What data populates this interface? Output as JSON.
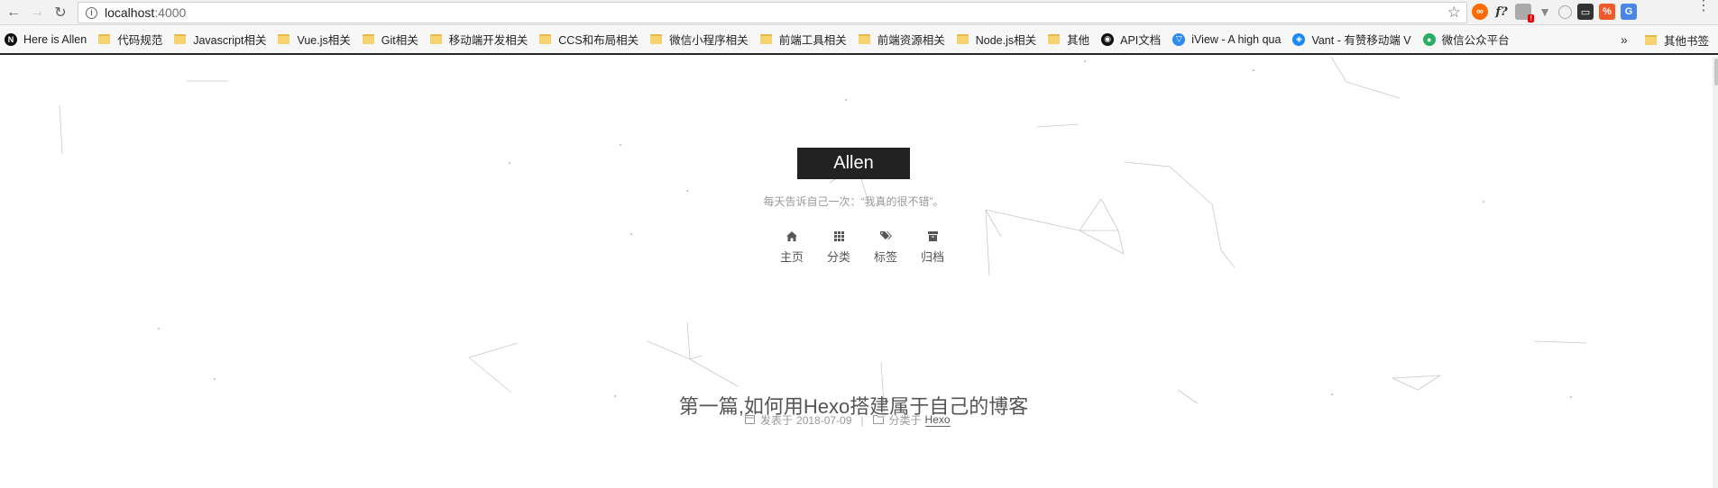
{
  "browser": {
    "url_host": "localhost",
    "url_port": ":4000"
  },
  "bookmarks": [
    {
      "label": "Here is Allen",
      "kind": "badge",
      "color": "#111111",
      "icon": "N"
    },
    {
      "label": "代码规范",
      "kind": "folder"
    },
    {
      "label": "Javascript相关",
      "kind": "folder"
    },
    {
      "label": "Vue.js相关",
      "kind": "folder"
    },
    {
      "label": "Git相关",
      "kind": "folder"
    },
    {
      "label": "移动端开发相关",
      "kind": "folder"
    },
    {
      "label": "CCS和布局相关",
      "kind": "folder"
    },
    {
      "label": "微信小程序相关",
      "kind": "folder"
    },
    {
      "label": "前端工具相关",
      "kind": "folder"
    },
    {
      "label": "前端资源相关",
      "kind": "folder"
    },
    {
      "label": "Node.js相关",
      "kind": "folder"
    },
    {
      "label": "其他",
      "kind": "folder"
    },
    {
      "label": "API文档",
      "kind": "badge",
      "color": "#111111",
      "icon": "◉"
    },
    {
      "label": "iView - A high qua",
      "kind": "badge",
      "color": "#2d8cf0",
      "icon": "▽"
    },
    {
      "label": "Vant - 有赞移动端 V",
      "kind": "badge",
      "color": "#1989fa",
      "icon": "◈"
    },
    {
      "label": "微信公众平台",
      "kind": "badge",
      "color": "#2aae67",
      "icon": "●"
    }
  ],
  "bookmarks_other": "其他书签",
  "bookmarks_overflow": "»",
  "site": {
    "brand": "Allen",
    "subtitle": "每天告诉自己一次：“我真的很不错”。",
    "menu": [
      {
        "label": "主页",
        "icon": "home-icon"
      },
      {
        "label": "分类",
        "icon": "grid-icon"
      },
      {
        "label": "标签",
        "icon": "tags-icon"
      },
      {
        "label": "归档",
        "icon": "archive-icon"
      }
    ]
  },
  "post": {
    "title": "第一篇,如何用Hexo搭建属于自己的博客",
    "posted_label": "发表于",
    "date": "2018-07-09",
    "separator": "|",
    "category_label": "分类于",
    "category": "Hexo"
  },
  "colors": {
    "brand_bg": "#222222",
    "folder": "#f6d36f",
    "text_muted": "#999999"
  }
}
